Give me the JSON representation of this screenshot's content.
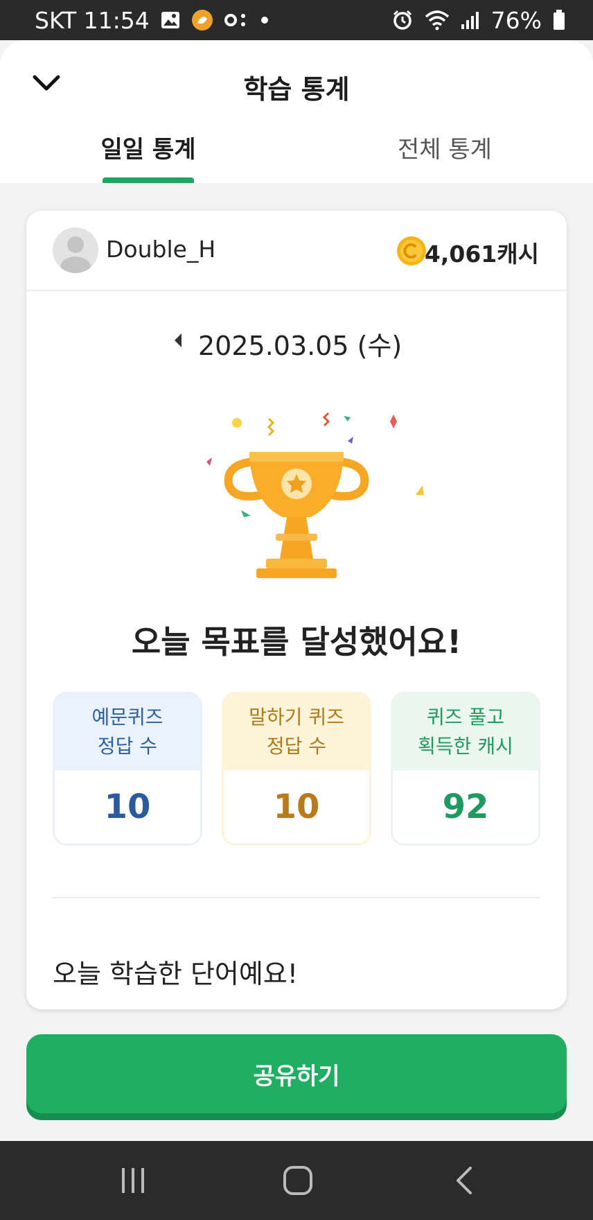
{
  "status_bar": {
    "carrier_time": "SKT 11:54",
    "battery": "76%",
    "icons": [
      "image-icon",
      "app-notification-icon",
      "voicemail-icon",
      "dot-icon",
      "alarm-icon",
      "wifi-icon",
      "signal-icon",
      "battery-icon"
    ]
  },
  "header": {
    "title": "학습 통계",
    "back_icon": "chevron-down-icon",
    "tabs": [
      {
        "label": "일일 통계",
        "active": true
      },
      {
        "label": "전체 통계",
        "active": false
      }
    ],
    "accent_color": "#1fa463"
  },
  "profile": {
    "username": "Double_H",
    "cash": "4,061캐시",
    "coin_icon": "coin-icon"
  },
  "date": {
    "text": "2025.03.05 (수)",
    "prev_icon": "caret-left-icon"
  },
  "goal_message": "오늘 목표를 달성했어요!",
  "stats": [
    {
      "label_line1": "예문퀴즈",
      "label_line2": "정답 수",
      "value": "10",
      "color": "#2b5b9c"
    },
    {
      "label_line1": "말하기 퀴즈",
      "label_line2": "정답 수",
      "value": "10",
      "color": "#b87a1c"
    },
    {
      "label_line1": "퀴즈 풀고",
      "label_line2": "획득한 캐시",
      "value": "92",
      "color": "#1e9a5e"
    }
  ],
  "words_title": "오늘 학습한 단어예요!",
  "share_button": "공유하기",
  "nav_bar": {
    "icons": [
      "recent-apps-icon",
      "home-icon",
      "back-icon"
    ]
  }
}
